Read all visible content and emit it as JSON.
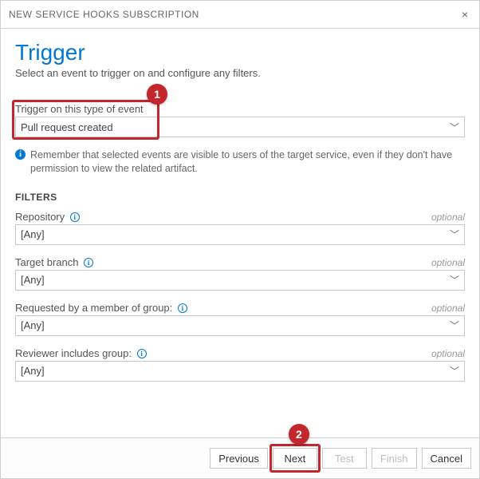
{
  "dialog": {
    "title": "NEW SERVICE HOOKS SUBSCRIPTION"
  },
  "header": {
    "page_title": "Trigger",
    "subtitle": "Select an event to trigger on and configure any filters."
  },
  "event": {
    "label": "Trigger on this type of event",
    "value": "Pull request created"
  },
  "note": "Remember that selected events are visible to users of the target service, even if they don't have permission to view the related artifact.",
  "filters": {
    "heading": "FILTERS",
    "repository": {
      "label": "Repository",
      "optional": "optional",
      "value": "[Any]"
    },
    "target_branch": {
      "label": "Target branch",
      "optional": "optional",
      "value": "[Any]"
    },
    "requested_group": {
      "label": "Requested by a member of group:",
      "optional": "optional",
      "value": "[Any]"
    },
    "reviewer_group": {
      "label": "Reviewer includes group:",
      "optional": "optional",
      "value": "[Any]"
    }
  },
  "footer": {
    "previous": "Previous",
    "next": "Next",
    "test": "Test",
    "finish": "Finish",
    "cancel": "Cancel"
  },
  "callouts": {
    "one": "1",
    "two": "2"
  }
}
